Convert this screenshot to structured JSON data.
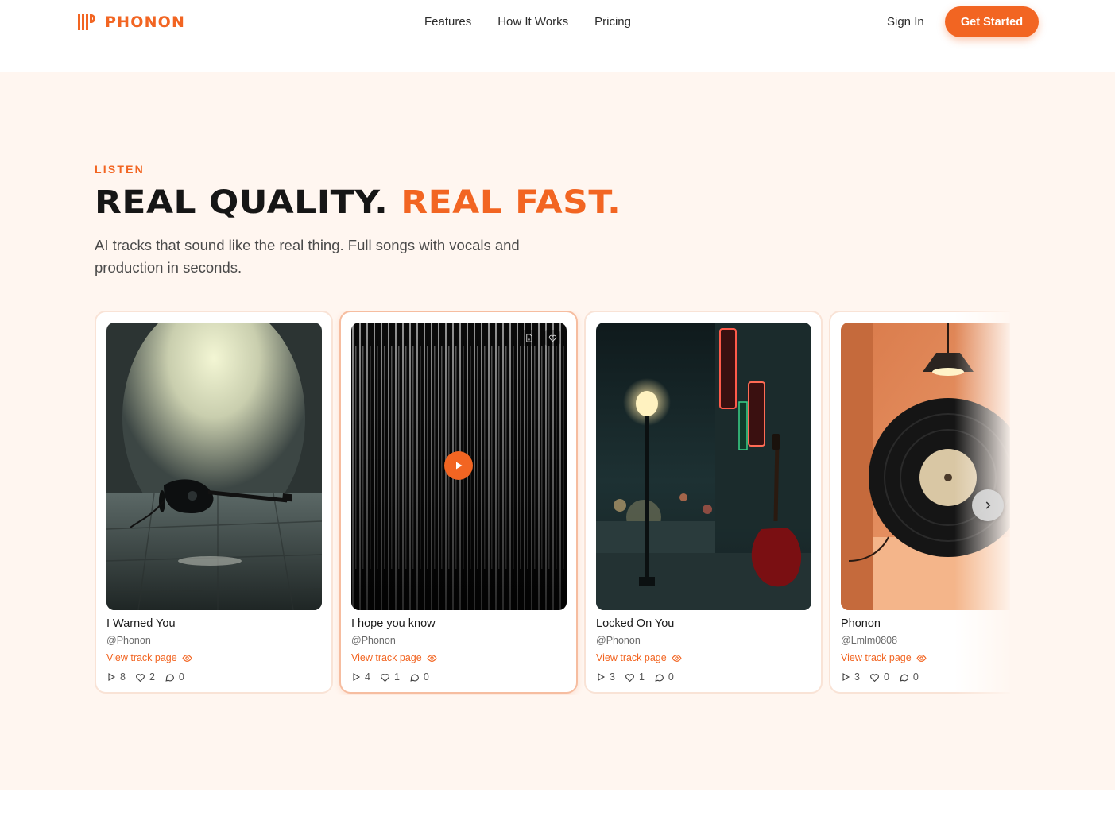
{
  "header": {
    "brand": "PHONON",
    "nav": [
      "Features",
      "How It Works",
      "Pricing"
    ],
    "sign_in": "Sign In",
    "get_started": "Get Started"
  },
  "section": {
    "eyebrow": "LISTEN",
    "headline_part1": "Real quality. ",
    "headline_part2": "Real fast.",
    "subtitle": "AI tracks that sound like the real thing. Full songs with vocals and production in seconds.",
    "link_label": "View track page"
  },
  "tracks": [
    {
      "title": "I Warned You",
      "artist": "@Phonon",
      "plays": "8",
      "likes": "2",
      "comments": "0"
    },
    {
      "title": "I hope you know",
      "artist": "@Phonon",
      "plays": "4",
      "likes": "1",
      "comments": "0"
    },
    {
      "title": "Locked On You",
      "artist": "@Phonon",
      "plays": "3",
      "likes": "1",
      "comments": "0"
    },
    {
      "title": "Phonon",
      "artist": "@Lmlm0808",
      "plays": "3",
      "likes": "0",
      "comments": "0"
    }
  ],
  "colors": {
    "accent": "#f26522",
    "section_bg": "#fff6f0"
  }
}
